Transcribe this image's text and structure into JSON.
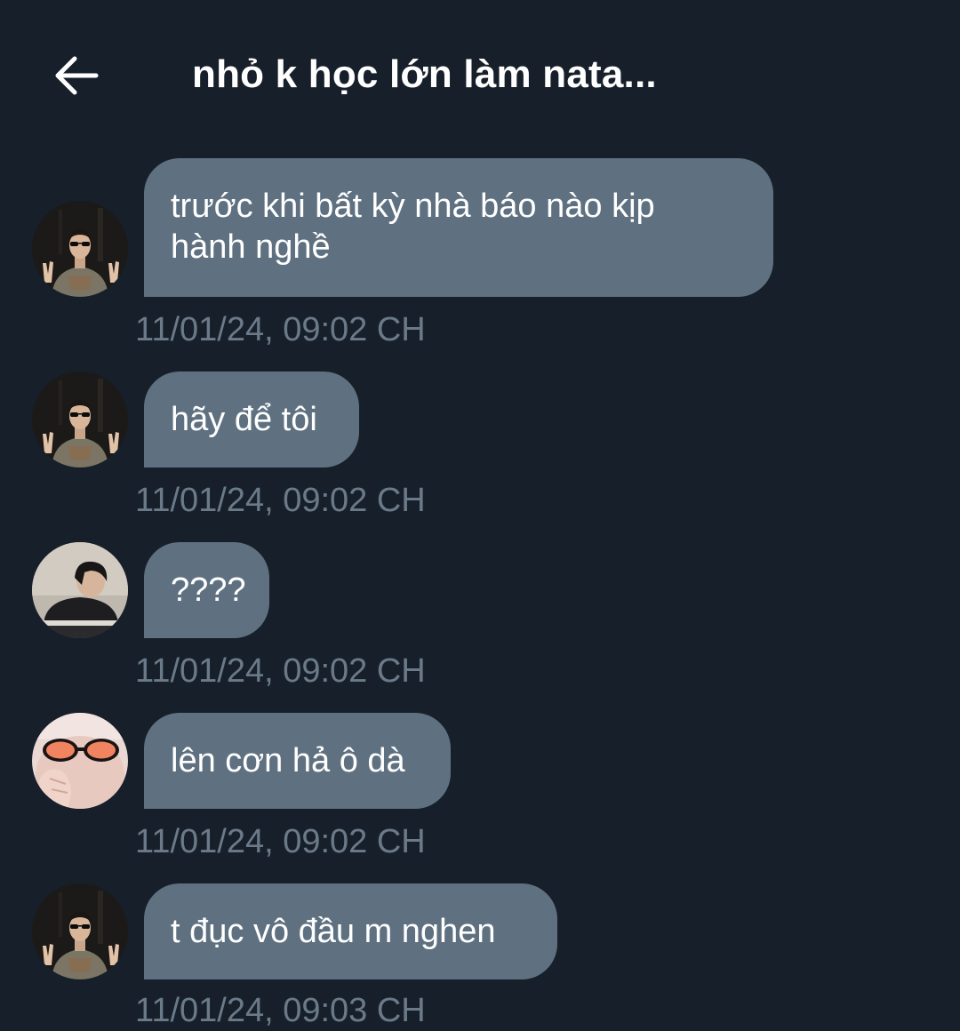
{
  "header": {
    "title": "nhỏ k học lớn làm nata..."
  },
  "messages": [
    {
      "text": "trước khi bất kỳ nhà báo nào kịp\nhành nghề",
      "time": "11/01/24, 09:02 CH",
      "avatar": "avatar-sunglasses-peace"
    },
    {
      "text": "hãy để tôi",
      "time": "11/01/24, 09:02 CH",
      "avatar": "avatar-sunglasses-peace"
    },
    {
      "text": "????",
      "time": "11/01/24, 09:02 CH",
      "avatar": "avatar-boy-laptop"
    },
    {
      "text": "lên cơn hả ô dà",
      "time": "11/01/24, 09:02 CH",
      "avatar": "avatar-orange-sunglasses"
    },
    {
      "text": "t đục vô đầu m nghen",
      "time": "11/01/24, 09:03 CH",
      "avatar": "avatar-sunglasses-peace"
    }
  ],
  "colors": {
    "background": "#17202a",
    "bubble": "#5f7181",
    "timestamp": "#6b7a89",
    "text": "#ffffff"
  }
}
